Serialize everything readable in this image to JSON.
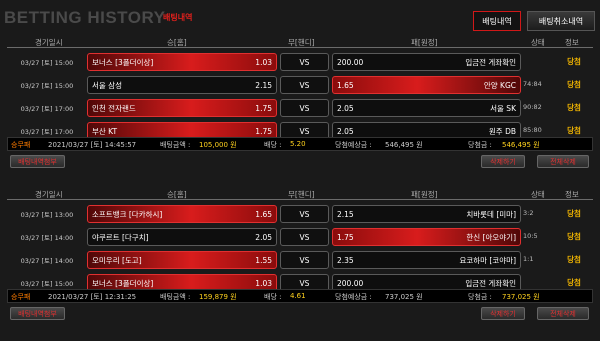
{
  "header": {
    "logo": "BETTING HISTORY",
    "subtitle": "배팅내역",
    "tab_history": "배팅내역",
    "tab_cancel": "배팅취소내역"
  },
  "columns": {
    "date": "경기일시",
    "home": "승[홈]",
    "draw": "무[핸디]",
    "away": "패[원정]",
    "score": "상태",
    "info": "정보"
  },
  "slips": [
    {
      "rows": [
        {
          "date": "03/27 [토] 15:00",
          "home": "보너스 [3폴더이상]",
          "home_odds": "1.03",
          "vs": "VS",
          "away_odds": "200.00",
          "away": "입금전 게좌확인",
          "score": "",
          "result": "당첨",
          "pick": "home"
        },
        {
          "date": "03/27 [토] 15:00",
          "home": "서울 삼성",
          "home_odds": "2.15",
          "vs": "VS",
          "away_odds": "1.65",
          "away": "안양 KGC",
          "score": "74:84",
          "result": "당첨",
          "pick": "away"
        },
        {
          "date": "03/27 [토] 17:00",
          "home": "인천 전자랜드",
          "home_odds": "1.75",
          "vs": "VS",
          "away_odds": "2.05",
          "away": "서울 SK",
          "score": "90:82",
          "result": "당첨",
          "pick": "home"
        },
        {
          "date": "03/27 [토] 17:00",
          "home": "부산 KT",
          "home_odds": "1.75",
          "vs": "VS",
          "away_odds": "2.05",
          "away": "원주 DB",
          "score": "85:80",
          "result": "당첨",
          "pick": "home"
        }
      ],
      "summary": {
        "status": "승무패",
        "datetime": "2021/03/27 [토] 14:45:57",
        "bet_label": "배팅금액 :",
        "bet_amount": "105,000 원",
        "odds_label": "배당 :",
        "odds": "5.20",
        "expected_label": "당첨예상금 :",
        "expected": "546,495 원",
        "win_label": "당첨금 :",
        "win": "546,495 원"
      },
      "buttons": {
        "add_board": "배팅내역첨부",
        "delete": "삭제하기",
        "delete_all": "전체삭제"
      }
    },
    {
      "rows": [
        {
          "date": "03/27 [토] 13:00",
          "home": "소프트뱅크 [다카하시]",
          "home_odds": "1.65",
          "vs": "VS",
          "away_odds": "2.15",
          "away": "치바롯데 [미마]",
          "score": "3:2",
          "result": "당첨",
          "pick": "home"
        },
        {
          "date": "03/27 [토] 14:00",
          "home": "야쿠르트 [다구치]",
          "home_odds": "2.05",
          "vs": "VS",
          "away_odds": "1.75",
          "away": "한신 [아오야기]",
          "score": "10:5",
          "result": "당첨",
          "pick": "away"
        },
        {
          "date": "03/27 [토] 14:00",
          "home": "오미우리 [도고]",
          "home_odds": "1.55",
          "vs": "VS",
          "away_odds": "2.35",
          "away": "요코하마 [코야마]",
          "score": "1:1",
          "result": "당첨",
          "pick": "home"
        },
        {
          "date": "03/27 [토] 15:00",
          "home": "보너스 [3폴더이상]",
          "home_odds": "1.03",
          "vs": "VS",
          "away_odds": "200.00",
          "away": "입금전 게좌확인",
          "score": "",
          "result": "당첨",
          "pick": "home"
        }
      ],
      "summary": {
        "status": "승무패",
        "datetime": "2021/03/27 [토] 12:31:25",
        "bet_label": "배팅금액 :",
        "bet_amount": "159,879 원",
        "odds_label": "배당 :",
        "odds": "4.61",
        "expected_label": "당첨예상금 :",
        "expected": "737,025 원",
        "win_label": "당첨금 :",
        "win": "737,025 원"
      },
      "buttons": {
        "add_board": "배팅내역첨부",
        "delete": "삭제하기",
        "delete_all": "전체삭제"
      }
    }
  ]
}
